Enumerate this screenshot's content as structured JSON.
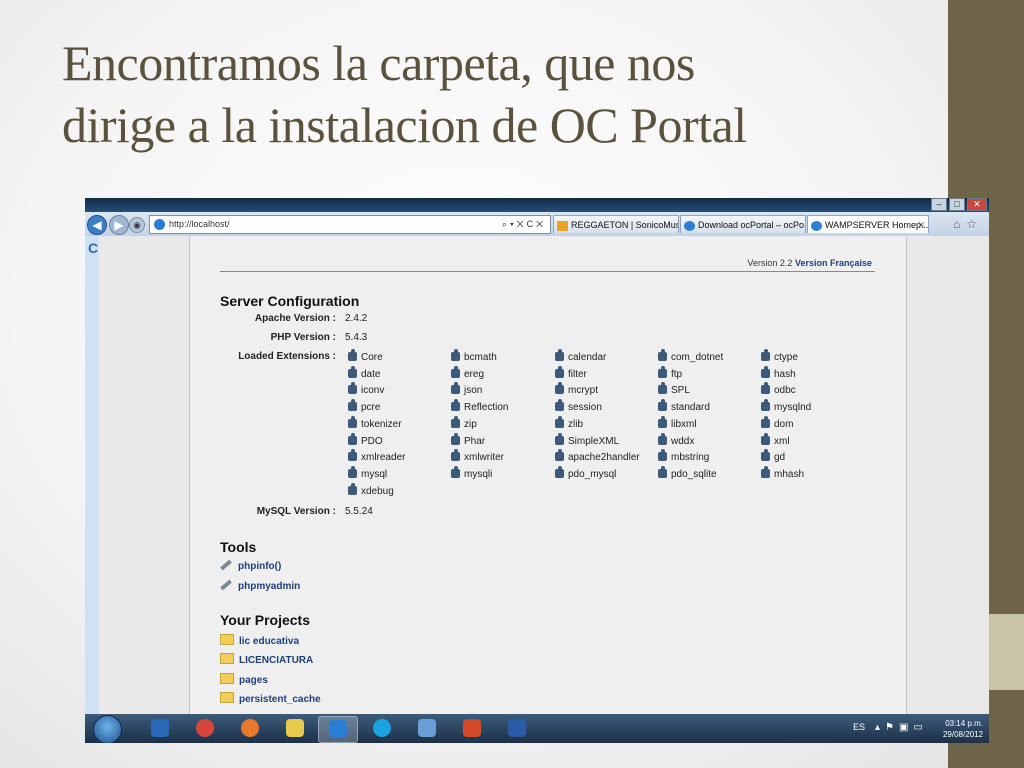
{
  "slide": {
    "title_line1": "Encontramos la carpeta, que nos",
    "title_line2": "dirige a la instalacion de OC Portal"
  },
  "browser": {
    "address": "http://localhost/",
    "tabs": [
      {
        "label": "REGGAETON | SonicoMusi...",
        "icon": "sonico-icon"
      },
      {
        "label": "Download ocPortal – ocPo...",
        "icon": "ie-page-icon"
      },
      {
        "label": "WAMPSERVER Homep...",
        "icon": "ie-page-icon",
        "active": true
      }
    ]
  },
  "wamp": {
    "version_text": "Version 2.2",
    "version_link": "Version Française",
    "server_config_title": "Server Configuration",
    "apache_label": "Apache Version :",
    "apache_value": "2.4.2",
    "php_label": "PHP Version :",
    "php_value": "5.4.3",
    "extensions_label": "Loaded Extensions :",
    "extensions": [
      [
        "Core",
        "bcmath",
        "calendar",
        "com_dotnet",
        "ctype"
      ],
      [
        "date",
        "ereg",
        "filter",
        "ftp",
        "hash"
      ],
      [
        "iconv",
        "json",
        "mcrypt",
        "SPL",
        "odbc"
      ],
      [
        "pcre",
        "Reflection",
        "session",
        "standard",
        "mysqlnd"
      ],
      [
        "tokenizer",
        "zip",
        "zlib",
        "libxml",
        "dom"
      ],
      [
        "PDO",
        "Phar",
        "SimpleXML",
        "wddx",
        "xml"
      ],
      [
        "xmlreader",
        "xmlwriter",
        "apache2handler",
        "mbstring",
        "gd"
      ],
      [
        "mysql",
        "mysqli",
        "pdo_mysql",
        "pdo_sqlite",
        "mhash"
      ],
      [
        "xdebug"
      ]
    ],
    "mysql_label": "MySQL Version :",
    "mysql_value": "5.5.24",
    "tools_title": "Tools",
    "tools": [
      "phpinfo()",
      "phpmyadmin"
    ],
    "projects_title": "Your Projects",
    "projects": [
      "lic educativa",
      "LICENCIATURA",
      "pages",
      "persistent_cache"
    ]
  },
  "taskbar": {
    "language": "ES",
    "time": "03:14 p.m.",
    "date": "29/08/2012",
    "apps": [
      "media-player-icon",
      "chrome-icon",
      "firefox-icon",
      "explorer-folder-icon",
      "internet-explorer-icon",
      "skype-icon",
      "paint-icon",
      "powerpoint-icon",
      "word-icon"
    ]
  },
  "colors": {
    "title": "#5a523c",
    "side_bar": "#6e6449",
    "side_accent": "#c9c4a6",
    "link": "#1f3f7a"
  }
}
